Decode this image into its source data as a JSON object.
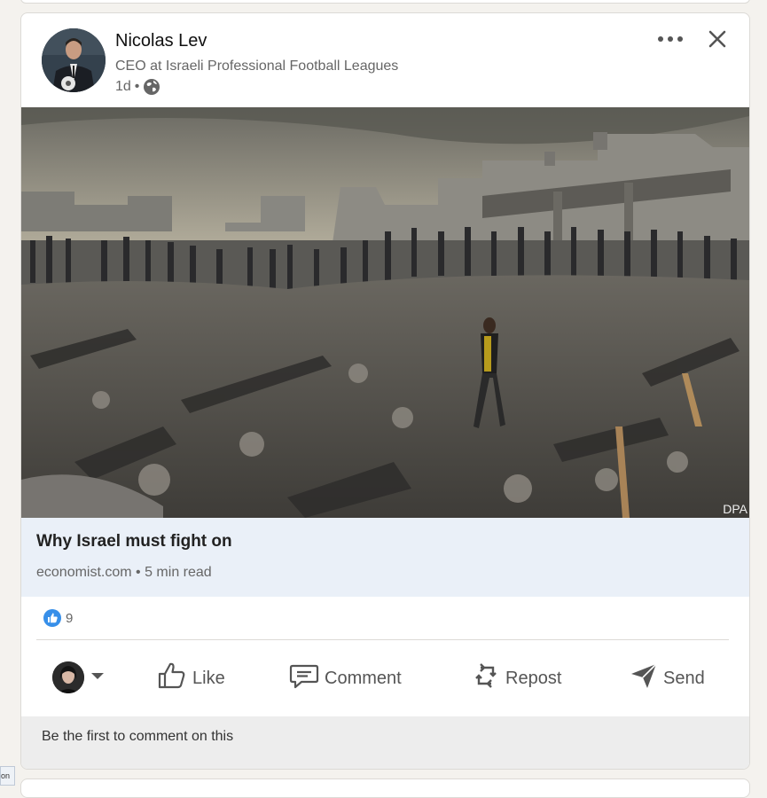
{
  "post": {
    "author_name": "Nicolas Lev",
    "author_headline": "CEO at Israeli Professional Football Leagues",
    "time": "1d",
    "separator": "•",
    "visibility_icon": "globe-icon",
    "image_credit": "DPA"
  },
  "article": {
    "title": "Why Israel must fight on",
    "source": "economist.com • 5 min read"
  },
  "reactions": {
    "icon": "thumbs-up-icon",
    "count": "9"
  },
  "actions": {
    "like": "Like",
    "comment": "Comment",
    "repost": "Repost",
    "send": "Send"
  },
  "comments": {
    "prompt": "Be the first to comment on this"
  },
  "side_tooltip": "on",
  "colors": {
    "page_bg": "#f4f2ee",
    "card_bg": "#ffffff",
    "article_bg": "#eaf0f8",
    "reaction_blue": "#378fe9",
    "comment_bg": "#ededed"
  }
}
